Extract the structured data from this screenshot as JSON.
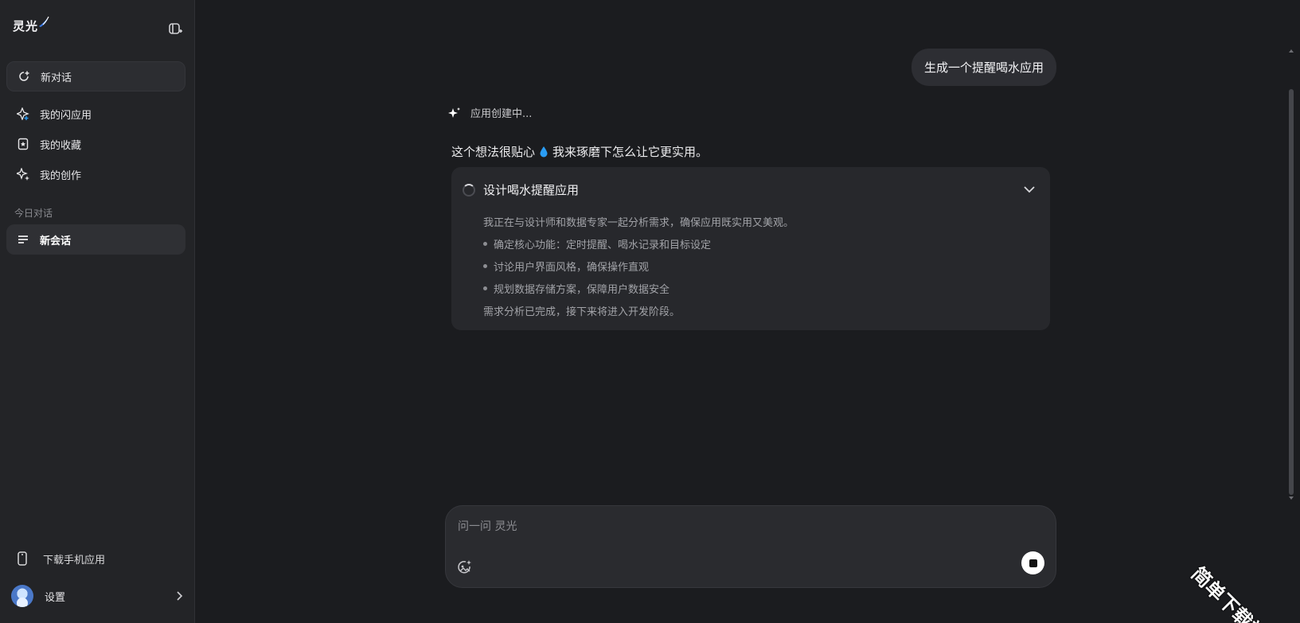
{
  "app": {
    "brand": "灵光"
  },
  "sidebar": {
    "new_chat": "新对话",
    "items": [
      {
        "label": "我的闪应用",
        "icon": "sparkle-app-icon"
      },
      {
        "label": "我的收藏",
        "icon": "bookmark-icon"
      },
      {
        "label": "我的创作",
        "icon": "creation-icon"
      }
    ],
    "section_today": "今日对话",
    "sessions": [
      {
        "label": "新会话",
        "icon": "list-icon"
      }
    ],
    "download_label": "下载手机应用",
    "settings_label": "设置"
  },
  "chat": {
    "user_message": "生成一个提醒喝水应用",
    "status": "应用创建中...",
    "reply_before": "这个想法很贴心",
    "reply_after": "我来琢磨下怎么让它更实用。",
    "task": {
      "title": "设计喝水提醒应用",
      "intro": "我正在与设计师和数据专家一起分析需求，确保应用既实用又美观。",
      "bullets": [
        "确定核心功能：定时提醒、喝水记录和目标设定",
        "讨论用户界面风格，确保操作直观",
        "规划数据存储方案，保障用户数据安全"
      ],
      "outro": "需求分析已完成，接下来将进入开发阶段。"
    }
  },
  "composer": {
    "placeholder": "问一问 灵光",
    "value": ""
  },
  "watermark": "简单下载站",
  "colors": {
    "background": "#1b1c1f",
    "sidebar": "#232427",
    "accent_drop": "#2a9df4"
  }
}
